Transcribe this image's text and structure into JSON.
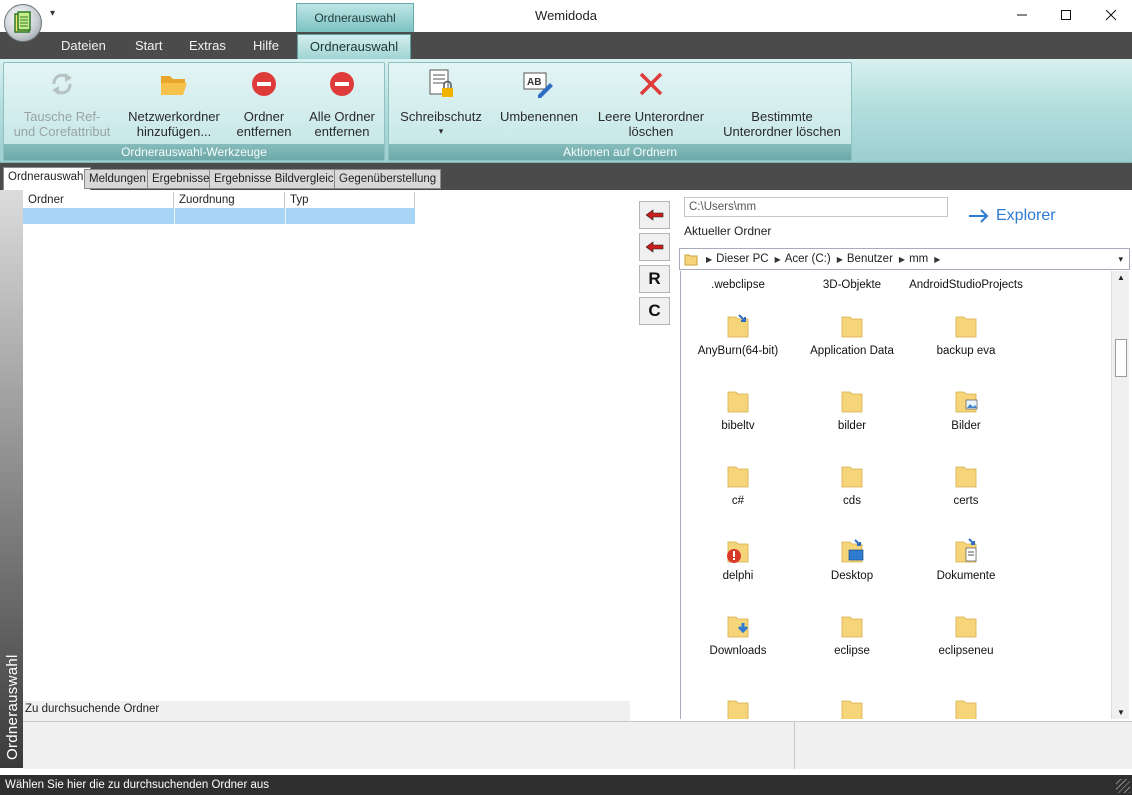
{
  "window": {
    "title": "Wemidoda",
    "context_tab_header": "Ordnerauswahl",
    "qat_glyph": "▾"
  },
  "ribbon_tabs": [
    "Dateien",
    "Start",
    "Extras",
    "Hilfe"
  ],
  "ribbon_active_tab": "Ordnerauswahl",
  "ribbon_groups": {
    "g1": {
      "label": "Ordnerauswahl-Werkzeuge",
      "buttons": [
        {
          "line1": "Tausche Ref-",
          "line2": "und Corefattribut",
          "icon": "refresh-icon",
          "enabled": false
        },
        {
          "line1": "Netzwerkordner",
          "line2": "hinzufügen...",
          "icon": "folder-open-icon",
          "enabled": true
        },
        {
          "line1": "Ordner",
          "line2": "entfernen",
          "icon": "no-entry-icon",
          "enabled": true
        },
        {
          "line1": "Alle Ordner",
          "line2": "entfernen",
          "icon": "no-entry-icon",
          "enabled": true
        }
      ]
    },
    "g2": {
      "label": "Aktionen auf Ordnern",
      "buttons": [
        {
          "line1": "Schreibschutz",
          "line2": "▾",
          "icon": "document-lock-icon"
        },
        {
          "line1": "Umbenennen",
          "line2": "",
          "icon": "rename-ab-icon"
        },
        {
          "line1": "Leere Unterordner",
          "line2": "löschen",
          "icon": "red-x-icon"
        },
        {
          "line1": "Bestimmte",
          "line2": "Unterordner löschen",
          "icon": "none"
        }
      ]
    }
  },
  "doc_tabs": [
    "Ordnerauswahl",
    "Meldungen",
    "Ergebnisse",
    "Ergebnisse Bildvergleich",
    "Gegenüberstellung"
  ],
  "side_label": "Ordnerauswahl",
  "grid": {
    "columns": [
      "Ordner",
      "Zuordnung",
      "Typ"
    ],
    "footer": "Zu durchsuchende Ordner"
  },
  "middle_buttons": [
    "◀",
    "◀",
    "R",
    "C"
  ],
  "right_pane": {
    "path_value": "C:\\Users\\mm",
    "current_folder_label": "Aktueller Ordner",
    "explorer_label": "Explorer",
    "breadcrumb": [
      "Dieser PC",
      "Acer (C:)",
      "Benutzer",
      "mm"
    ],
    "files": [
      {
        "name": ".webclipse",
        "kind": "partial"
      },
      {
        "name": "3D-Objekte",
        "kind": "partial"
      },
      {
        "name": "AndroidStudioProjects",
        "kind": "partial"
      },
      {
        "name": "AnyBurn(64-bit)",
        "kind": "folder-badge-arrows"
      },
      {
        "name": "Application Data",
        "kind": "folder"
      },
      {
        "name": "backup eva",
        "kind": "folder"
      },
      {
        "name": "bibeltv",
        "kind": "folder"
      },
      {
        "name": "bilder",
        "kind": "folder"
      },
      {
        "name": "Bilder",
        "kind": "folder-badge-picture"
      },
      {
        "name": "c#",
        "kind": "folder"
      },
      {
        "name": "cds",
        "kind": "folder"
      },
      {
        "name": "certs",
        "kind": "folder"
      },
      {
        "name": "delphi",
        "kind": "folder-badge-error"
      },
      {
        "name": "Desktop",
        "kind": "folder-badge-desktop"
      },
      {
        "name": "Dokumente",
        "kind": "folder-badge-doc"
      },
      {
        "name": "Downloads",
        "kind": "folder-badge-download"
      },
      {
        "name": "eclipse",
        "kind": "folder"
      },
      {
        "name": "eclipseneu",
        "kind": "folder"
      }
    ]
  },
  "status_text": "Wählen Sie hier die zu durchsuchenden Ordner aus",
  "colors": {
    "ribbon_teal": "#9ccfcf",
    "dark_bar": "#4b4b4b",
    "selection_blue": "#a8d4f5",
    "explorer_blue": "#2e7bd1",
    "folder_yellow": "#f6d57a",
    "delete_red": "#e03b3b"
  }
}
